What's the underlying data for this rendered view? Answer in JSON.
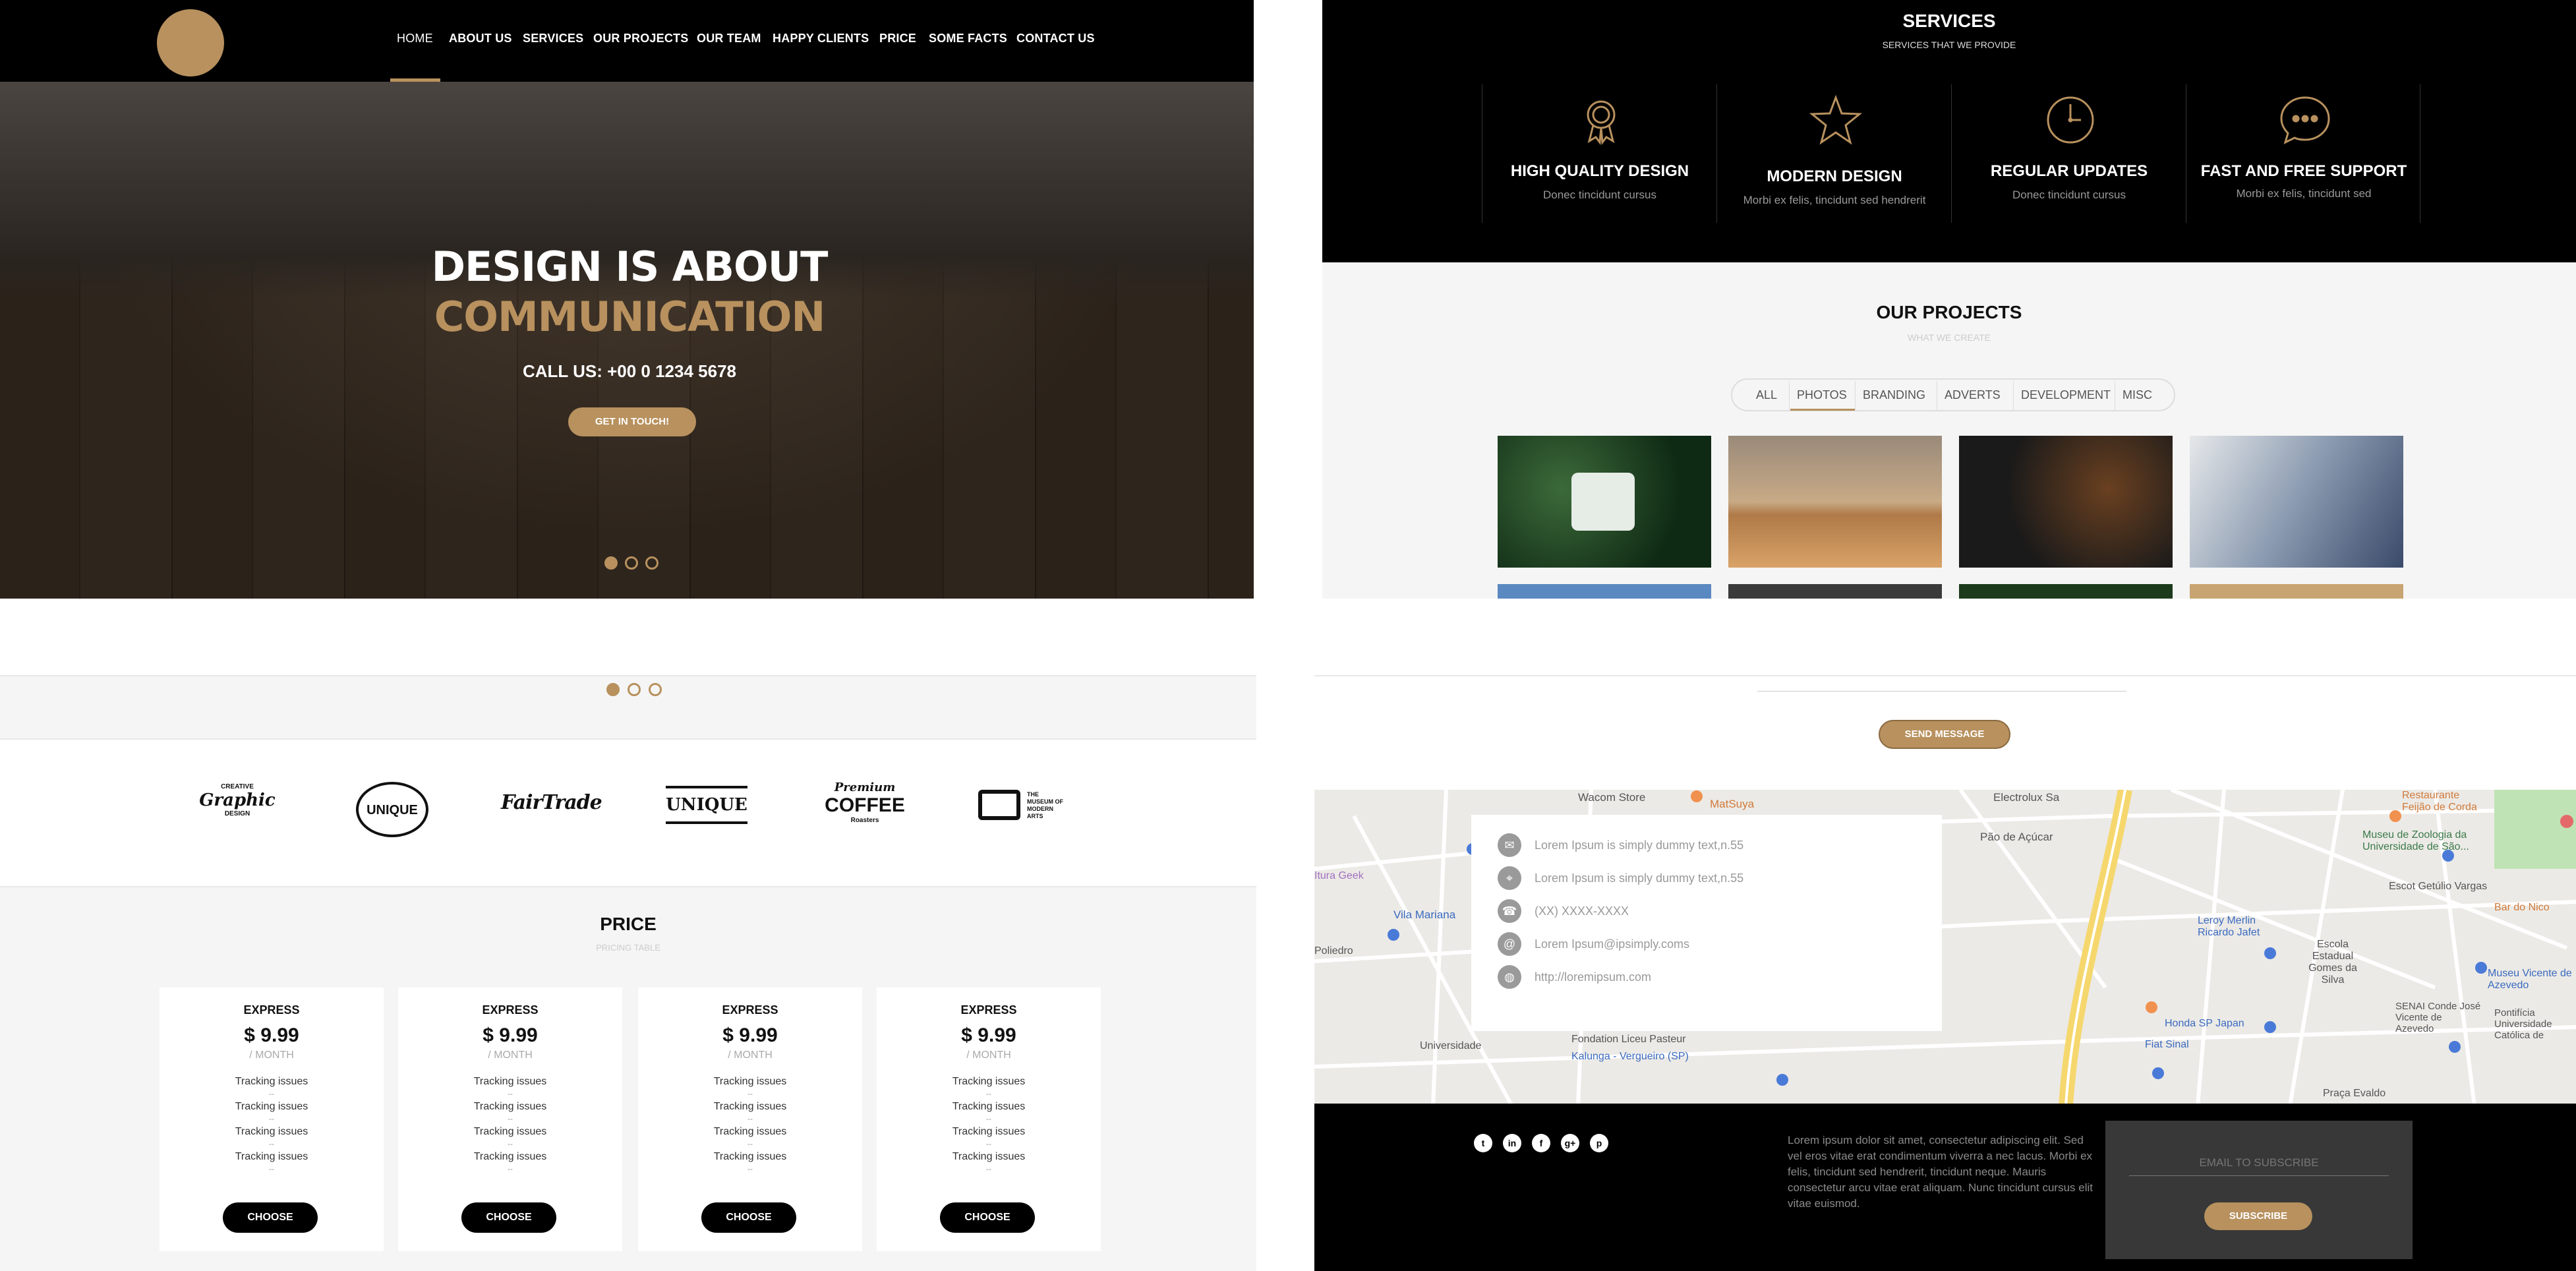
{
  "nav": {
    "items": [
      "HOME",
      "ABOUT US",
      "SERVICES",
      "OUR PROJECTS",
      "OUR TEAM",
      "HAPPY CLIENTS",
      "PRICE",
      "SOME FACTS",
      "CONTACT US"
    ]
  },
  "hero": {
    "line1": "DESIGN IS ABOUT",
    "line2": "COMMUNICATION",
    "call": "CALL US: +00 0 1234 5678",
    "button": "GET IN TOUCH!",
    "slides_total": 3,
    "slide_active": 1
  },
  "services": {
    "title": "SERVICES",
    "subtitle": "SERVICES THAT WE PROVIDE",
    "items": [
      {
        "icon": "award-icon",
        "title": "HIGH QUALITY DESIGN",
        "desc": "Donec tincidunt cursus"
      },
      {
        "icon": "star-icon",
        "title": "MODERN DESIGN",
        "desc": "Morbi ex felis, tincidunt sed hendrerit"
      },
      {
        "icon": "clock-icon",
        "title": "REGULAR UPDATES",
        "desc": "Donec tincidunt cursus"
      },
      {
        "icon": "chat-icon",
        "title": "FAST AND FREE SUPPORT",
        "desc": "Morbi ex felis, tincidunt sed"
      }
    ]
  },
  "projects": {
    "title": "OUR PROJECTS",
    "subtitle": "WHAT WE CREATE",
    "filters": [
      "ALL",
      "PHOTOS",
      "BRANDING",
      "ADVERTS",
      "DEVELOPMENT",
      "MISC"
    ],
    "active_filter": "PHOTOS"
  },
  "brands": {
    "items": [
      {
        "line1": "CREATIVE",
        "line2": "Graphic",
        "line3": "DESIGN"
      },
      {
        "line1": "",
        "line2": "UNIQUE",
        "line3": ""
      },
      {
        "line1": "",
        "line2": "FairTrade",
        "line3": ""
      },
      {
        "line1": "",
        "line2": "UNIQUE",
        "line3": ""
      },
      {
        "line1": "Premium",
        "line2": "COFFEE",
        "line3": "Roasters"
      },
      {
        "line1": "",
        "line2": "THE MUSEUM OF MODERN ARTS",
        "line3": ""
      }
    ]
  },
  "price": {
    "title": "PRICE",
    "subtitle": "PRICING TABLE",
    "cards": [
      {
        "name": "EXPRESS",
        "price": "$ 9.99",
        "period": "/ MONTH",
        "features": [
          "Tracking issues",
          "Tracking issues",
          "Tracking issues",
          "Tracking issues"
        ],
        "button": "CHOOSE"
      },
      {
        "name": "EXPRESS",
        "price": "$ 9.99",
        "period": "/ MONTH",
        "features": [
          "Tracking issues",
          "Tracking issues",
          "Tracking issues",
          "Tracking issues"
        ],
        "button": "CHOOSE"
      },
      {
        "name": "EXPRESS",
        "price": "$ 9.99",
        "period": "/ MONTH",
        "features": [
          "Tracking issues",
          "Tracking issues",
          "Tracking issues",
          "Tracking issues"
        ],
        "button": "CHOOSE"
      },
      {
        "name": "EXPRESS",
        "price": "$ 9.99",
        "period": "/ MONTH",
        "features": [
          "Tracking issues",
          "Tracking issues",
          "Tracking issues",
          "Tracking issues"
        ],
        "button": "CHOOSE"
      }
    ],
    "divider": "--"
  },
  "contact": {
    "send_button": "SEND MESSAGE",
    "info": [
      {
        "icon": "mail-icon",
        "text": "Lorem Ipsum is simply dummy text,n.55"
      },
      {
        "icon": "location-icon",
        "text": "Lorem Ipsum is simply dummy text,n.55"
      },
      {
        "icon": "phone-icon",
        "text": "(XX) XXXX-XXXX"
      },
      {
        "icon": "at-icon",
        "text": "Lorem Ipsum@ipsimply.coms"
      },
      {
        "icon": "globe-icon",
        "text": "http://loremipsum.com"
      }
    ]
  },
  "map": {
    "labels": [
      "Wacom Store",
      "MatSuya",
      "Electrolux Sa",
      "Restaurante Feijão de Corda",
      "Museu de Zoologia da Universidade de São...",
      "Pão de Açúcar",
      "Vila Mariana",
      "Leroy Merlin Ricardo Jafet",
      "Bar do Nico",
      "Escola Estadual Gomes da Silva",
      "Escot Getúlio Vargas",
      "Museu Vicente de Azevedo",
      "SENAI Conde José Vicente de Azevedo",
      "Pontifícia Universidade Católica de",
      "Fondation Liceu Pasteur",
      "Honda SP Japan",
      "Fiat Sinal",
      "Universidade",
      "Kalunga - Vergueiro (SP)",
      "Praça Evaldo",
      "Poliedro",
      "Itura Geek"
    ]
  },
  "footer": {
    "social": [
      "t",
      "in",
      "f",
      "g+",
      "p"
    ],
    "paragraph": "Lorem ipsum dolor sit amet, consectetur adipiscing elit. Sed vel eros vitae erat condimentum viverra a nec lacus. Morbi ex felis, tincidunt sed hendrerit, tincidunt neque. Mauris consectetur arcu vitae erat aliquam. Nunc tincidunt cursus elit vitae euismod.",
    "email_placeholder": "EMAIL TO SUBSCRIBE",
    "subscribe": "SUBSCRIBE"
  },
  "colors": {
    "accent": "#b8915e",
    "dark": "#000000",
    "light": "#f5f5f5"
  }
}
